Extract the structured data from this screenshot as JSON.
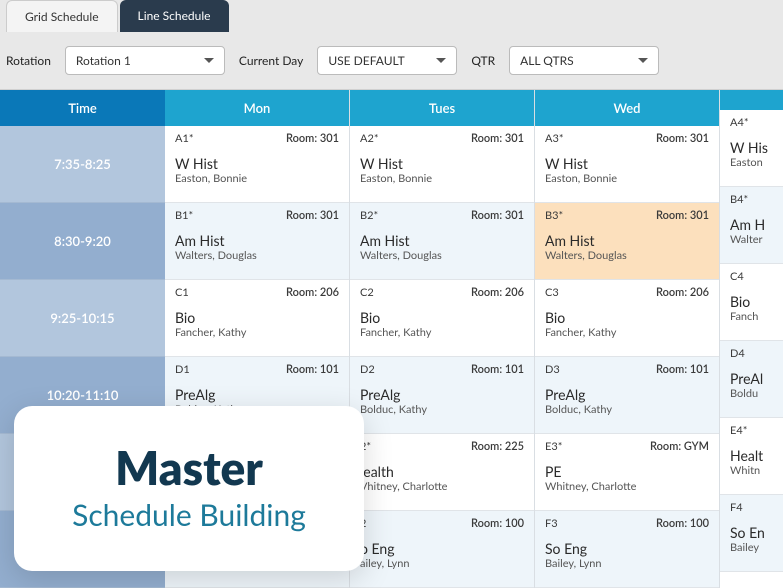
{
  "tabs": {
    "grid": "Grid Schedule",
    "line": "Line Schedule"
  },
  "controls": {
    "rotation_label": "Rotation",
    "rotation_value": "Rotation 1",
    "day_label": "Current Day",
    "day_value": "USE DEFAULT",
    "qtr_label": "QTR",
    "qtr_value": "ALL QTRS"
  },
  "headers": {
    "time": "Time",
    "days": [
      "Mon",
      "Tues",
      "Wed",
      ""
    ]
  },
  "rows": [
    {
      "time": "7:35-8:25",
      "alt": false,
      "cells": [
        {
          "period": "A1*",
          "room": "Room: 301",
          "course": "W Hist",
          "teacher": "Easton, Bonnie"
        },
        {
          "period": "A2*",
          "room": "Room: 301",
          "course": "W Hist",
          "teacher": "Easton, Bonnie"
        },
        {
          "period": "A3*",
          "room": "Room: 301",
          "course": "W Hist",
          "teacher": "Easton, Bonnie"
        },
        {
          "period": "A4*",
          "room": "",
          "course": "W His",
          "teacher": "Easton"
        }
      ]
    },
    {
      "time": "8:30-9:20",
      "alt": true,
      "cells": [
        {
          "period": "B1*",
          "room": "Room: 301",
          "course": "Am Hist",
          "teacher": "Walters, Douglas"
        },
        {
          "period": "B2*",
          "room": "Room: 301",
          "course": "Am Hist",
          "teacher": "Walters, Douglas"
        },
        {
          "period": "B3*",
          "room": "Room: 301",
          "course": "Am Hist",
          "teacher": "Walters, Douglas",
          "hl": true
        },
        {
          "period": "B4*",
          "room": "",
          "course": "Am H",
          "teacher": "Walter"
        }
      ]
    },
    {
      "time": "9:25-10:15",
      "alt": false,
      "cells": [
        {
          "period": "C1",
          "room": "Room: 206",
          "course": "Bio",
          "teacher": "Fancher, Kathy"
        },
        {
          "period": "C2",
          "room": "Room: 206",
          "course": "Bio",
          "teacher": "Fancher, Kathy"
        },
        {
          "period": "C3",
          "room": "Room: 206",
          "course": "Bio",
          "teacher": "Fancher, Kathy"
        },
        {
          "period": "C4",
          "room": "",
          "course": "Bio",
          "teacher": "Fanch"
        }
      ]
    },
    {
      "time": "10:20-11:10",
      "alt": true,
      "cells": [
        {
          "period": "D1",
          "room": "Room: 101",
          "course": "PreAlg",
          "teacher": "Bolduc, Kathy"
        },
        {
          "period": "D2",
          "room": "Room: 101",
          "course": "PreAlg",
          "teacher": "Bolduc, Kathy"
        },
        {
          "period": "D3",
          "room": "Room: 101",
          "course": "PreAlg",
          "teacher": "Bolduc, Kathy"
        },
        {
          "period": "D4",
          "room": "",
          "course": "PreAl",
          "teacher": "Boldu"
        }
      ]
    },
    {
      "time": "",
      "alt": false,
      "cells": [
        {
          "period": "",
          "room": "",
          "course": "",
          "teacher": ""
        },
        {
          "period": "2*",
          "room": "Room: 225",
          "course": "lealth",
          "teacher": "Vhitney, Charlotte"
        },
        {
          "period": "E3*",
          "room": "Room: GYM",
          "course": "PE",
          "teacher": "Whitney, Charlotte"
        },
        {
          "period": "E4*",
          "room": "",
          "course": "Healt",
          "teacher": "Whitn"
        }
      ]
    },
    {
      "time": "",
      "alt": true,
      "cells": [
        {
          "period": "",
          "room": "",
          "course": "",
          "teacher": ""
        },
        {
          "period": "2",
          "room": "Room: 100",
          "course": "o Eng",
          "teacher": "ailey, Lynn"
        },
        {
          "period": "F3",
          "room": "Room: 100",
          "course": "So Eng",
          "teacher": "Bailey, Lynn"
        },
        {
          "period": "F4",
          "room": "",
          "course": "So En",
          "teacher": "Bailey"
        }
      ]
    }
  ],
  "overlay": {
    "title": "Master",
    "subtitle": "Schedule Building"
  }
}
